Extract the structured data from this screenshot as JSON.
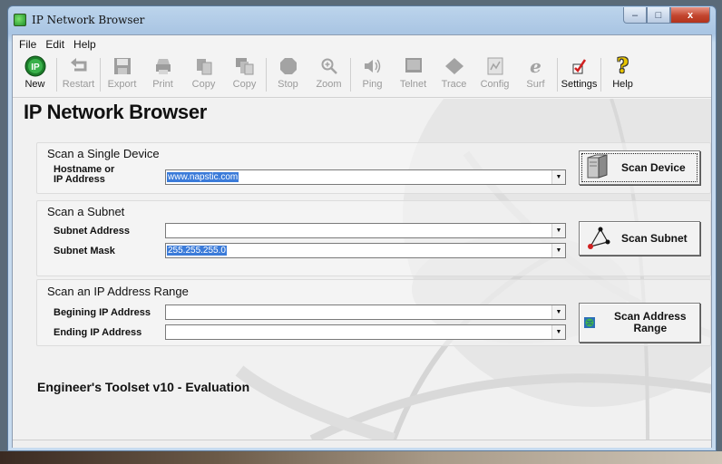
{
  "window": {
    "title": "IP Network Browser",
    "buttons": {
      "minimize": "–",
      "maximize": "□",
      "close": "x"
    }
  },
  "menu": [
    "File",
    "Edit",
    "Help"
  ],
  "toolbar": [
    {
      "label": "New",
      "icon": "new-icon",
      "enabled": true
    },
    {
      "label": "Restart",
      "icon": "restart-icon",
      "enabled": false
    },
    {
      "label": "Export",
      "icon": "save-icon",
      "enabled": false
    },
    {
      "label": "Print",
      "icon": "print-icon",
      "enabled": false
    },
    {
      "label": "Copy",
      "icon": "copy-icon",
      "enabled": false
    },
    {
      "label": "Copy",
      "icon": "copy-all-icon",
      "enabled": false
    },
    {
      "label": "Stop",
      "icon": "stop-icon",
      "enabled": false
    },
    {
      "label": "Zoom",
      "icon": "zoom-icon",
      "enabled": false
    },
    {
      "label": "Ping",
      "icon": "ping-icon",
      "enabled": false
    },
    {
      "label": "Telnet",
      "icon": "telnet-icon",
      "enabled": false
    },
    {
      "label": "Trace",
      "icon": "trace-icon",
      "enabled": false
    },
    {
      "label": "Config",
      "icon": "config-icon",
      "enabled": false
    },
    {
      "label": "Surf",
      "icon": "surf-icon",
      "enabled": false
    },
    {
      "label": "Settings",
      "icon": "settings-icon",
      "enabled": true
    },
    {
      "label": "Help",
      "icon": "help-icon",
      "enabled": true
    }
  ],
  "page_title": "IP Network Browser",
  "single": {
    "title": "Scan a Single Device",
    "host_label_1": "Hostname or",
    "host_label_2": "IP Address",
    "host_value": "www.napstic.com",
    "button": "Scan Device"
  },
  "subnet": {
    "title": "Scan a Subnet",
    "address_label": "Subnet Address",
    "address_value": "",
    "mask_label": "Subnet Mask",
    "mask_value": "255.255.255.0",
    "button": "Scan Subnet"
  },
  "range": {
    "title": "Scan an IP Address Range",
    "begin_label": "Begining IP Address",
    "begin_value": "",
    "end_label": "Ending IP Address",
    "end_value": "",
    "button_1": "Scan Address",
    "button_2": "Range"
  },
  "footer": "Engineer's Toolset v10 - Evaluation",
  "colors": {
    "selection": "#3b7bd9",
    "accent_green": "#1f8f2b",
    "settings_red": "#d02020",
    "help_yellow": "#e8c400"
  }
}
